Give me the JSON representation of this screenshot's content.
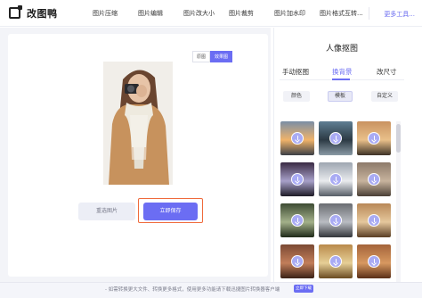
{
  "app": {
    "logo_text": "改图鸭"
  },
  "nav": {
    "items": [
      "图片压缩",
      "图片编辑",
      "图片改大小",
      "图片裁剪",
      "图片加水印",
      "图片格式互转..."
    ],
    "more": "更多工具..."
  },
  "canvas": {
    "toggle": [
      "原图",
      "效果图"
    ],
    "reselect_label": "重选图片",
    "save_label": "立即保存"
  },
  "panel": {
    "title": "人像抠图",
    "tabs": [
      "手动抠图",
      "换背景",
      "改尺寸"
    ],
    "active_tab": "换背景",
    "sub_tabs": [
      "颜色",
      "模板",
      "自定义"
    ],
    "active_sub_tab": "模板",
    "thumbnails": [
      {
        "scene": "road-sunset",
        "colors": [
          "#7a8ea5",
          "#f0b36a",
          "#3b3f46"
        ]
      },
      {
        "scene": "highway",
        "colors": [
          "#5f7e93",
          "#2c3a44",
          "#8a9aa5"
        ]
      },
      {
        "scene": "sunset-road",
        "colors": [
          "#c99260",
          "#e9c08a",
          "#3d3226"
        ]
      },
      {
        "scene": "dark-portal",
        "colors": [
          "#3a2a44",
          "#a7a0c9",
          "#1e1b26"
        ]
      },
      {
        "scene": "white-road",
        "colors": [
          "#9ea6b1",
          "#e9ebee",
          "#565d66"
        ]
      },
      {
        "scene": "canyon-road",
        "colors": [
          "#8d7a6a",
          "#c7b39d",
          "#4a3f36"
        ]
      },
      {
        "scene": "forest-path",
        "colors": [
          "#3d4b33",
          "#a3b08a",
          "#1f2a18"
        ]
      },
      {
        "scene": "rocks",
        "colors": [
          "#6a6d72",
          "#b9bcc2",
          "#33363b"
        ]
      },
      {
        "scene": "deer",
        "colors": [
          "#b98958",
          "#e5c79c",
          "#5a3e24"
        ]
      },
      {
        "scene": "brick",
        "colors": [
          "#7b4a33",
          "#c27e5a",
          "#3a2216"
        ]
      },
      {
        "scene": "gold-field",
        "colors": [
          "#b98a4b",
          "#e6cf96",
          "#6a4a21"
        ]
      },
      {
        "scene": "autumn",
        "colors": [
          "#a4643a",
          "#d79860",
          "#5a2f18"
        ]
      }
    ]
  },
  "banner": {
    "text": "- 如需转换更大文件、转换更多格式，使用更多功能请下载迅捷图片转换器客户端",
    "button": "立即下载"
  },
  "colors": {
    "accent": "#6b6df3",
    "highlight_border": "#ef6a3b"
  }
}
